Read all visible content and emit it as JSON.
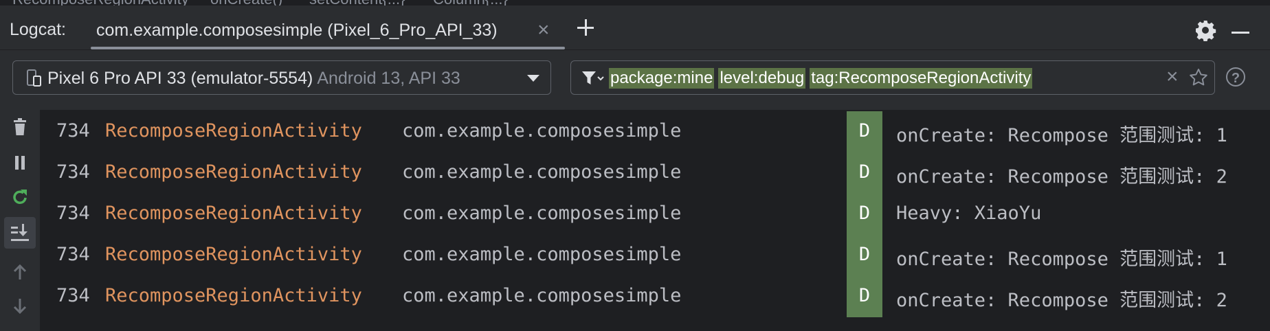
{
  "breadcrumbs": [
    "RecomposeRegionActivity",
    "onCreate()",
    "setContent{...}",
    "Column{...}"
  ],
  "toolwindow": {
    "label": "Logcat:",
    "tab_label": "com.example.composesimple (Pixel_6_Pro_API_33)",
    "close_glyph": "×"
  },
  "device_selector": {
    "name": "Pixel 6 Pro API 33 (emulator-5554)",
    "detail": "Android 13, API 33"
  },
  "filter": {
    "chips": [
      "package:mine",
      "level:debug",
      "tag:RecomposeRegionActivity"
    ],
    "clear_glyph": "×",
    "help_glyph": "?"
  },
  "sidebar": {
    "icons": [
      "trash-icon",
      "pause-icon",
      "restart-icon",
      "scroll-to-end-icon",
      "up-arrow-icon",
      "down-arrow-icon"
    ]
  },
  "log_rows": [
    {
      "pid": "734",
      "tag": "RecomposeRegionActivity",
      "package": "com.example.composesimple",
      "level": "D",
      "message": "onCreate: Recompose 范围测试: 1"
    },
    {
      "pid": "734",
      "tag": "RecomposeRegionActivity",
      "package": "com.example.composesimple",
      "level": "D",
      "message": "onCreate: Recompose 范围测试: 2"
    },
    {
      "pid": "734",
      "tag": "RecomposeRegionActivity",
      "package": "com.example.composesimple",
      "level": "D",
      "message": "Heavy: XiaoYu"
    },
    {
      "pid": "734",
      "tag": "RecomposeRegionActivity",
      "package": "com.example.composesimple",
      "level": "D",
      "message": "onCreate: Recompose 范围测试: 1"
    },
    {
      "pid": "734",
      "tag": "RecomposeRegionActivity",
      "package": "com.example.composesimple",
      "level": "D",
      "message": "onCreate: Recompose 范围测试: 2"
    }
  ],
  "colors": {
    "tag": "#e0945f",
    "level_debug_bg": "#5c8052",
    "chip_bg": "#5c7346",
    "log_bg": "#1e1f22",
    "panel_bg": "#2b2d30"
  }
}
